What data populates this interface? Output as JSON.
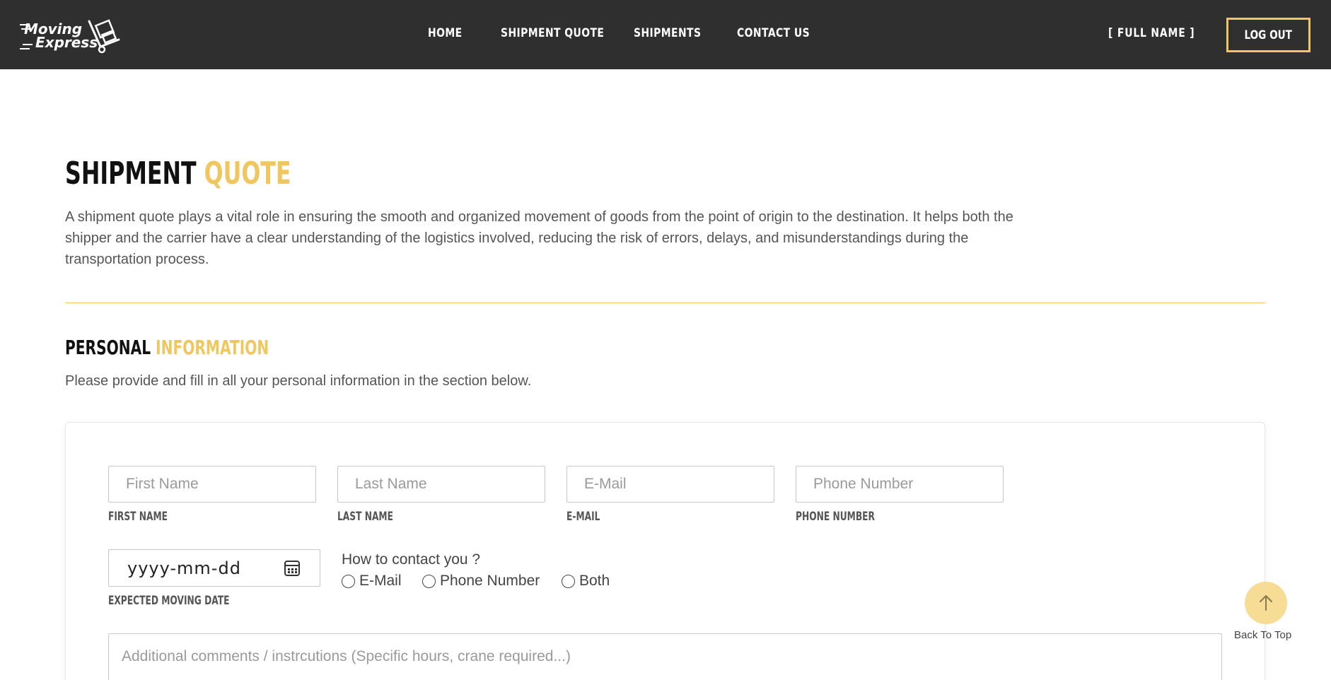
{
  "brand": {
    "line1": "Moving",
    "line2": "Express"
  },
  "nav": {
    "items": [
      {
        "label": "HOME"
      },
      {
        "label": "SHIPMENT QUOTE"
      },
      {
        "label": "SHIPMENTS"
      },
      {
        "label": "CONTACT US"
      }
    ],
    "user_name": "[ FULL NAME ]",
    "logout_label": "LOG OUT"
  },
  "page": {
    "title_main": "SHIPMENT",
    "title_accent": "QUOTE",
    "intro": "A shipment quote plays a vital role in ensuring the smooth and organized movement of goods from the point of origin to the destination. It helps both the shipper and the carrier have a clear understanding of the logistics involved, reducing the risk of errors, delays, and misunderstandings during the transportation process."
  },
  "personal": {
    "title_main": "PERSONAL",
    "title_accent": "INFORMATION",
    "description": "Please provide and fill in all your personal information in the section below.",
    "fields": {
      "first_name": {
        "placeholder": "First Name",
        "label": "FIRST NAME",
        "value": ""
      },
      "last_name": {
        "placeholder": "Last Name",
        "label": "LAST NAME",
        "value": ""
      },
      "email": {
        "placeholder": "E-Mail",
        "label": "E-MAIL",
        "value": ""
      },
      "phone": {
        "placeholder": "Phone Number",
        "label": "PHONE NUMBER",
        "value": ""
      }
    },
    "moving_date": {
      "display": "yyyy-mm-dd",
      "label": "EXPECTED MOVING DATE"
    },
    "contact": {
      "question": "How to contact you ?",
      "options": [
        {
          "label": "E-Mail",
          "selected": false
        },
        {
          "label": "Phone Number",
          "selected": false
        },
        {
          "label": "Both",
          "selected": false
        }
      ]
    },
    "comments": {
      "placeholder": "Additional comments / instrcutions (Specific hours, crane required...)",
      "value": ""
    }
  },
  "back_to_top": {
    "label": "Back To Top"
  },
  "colors": {
    "accent": "#f0c75e",
    "navbar": "#2f2f2f",
    "back_to_top_bg": "#f6dc94"
  }
}
